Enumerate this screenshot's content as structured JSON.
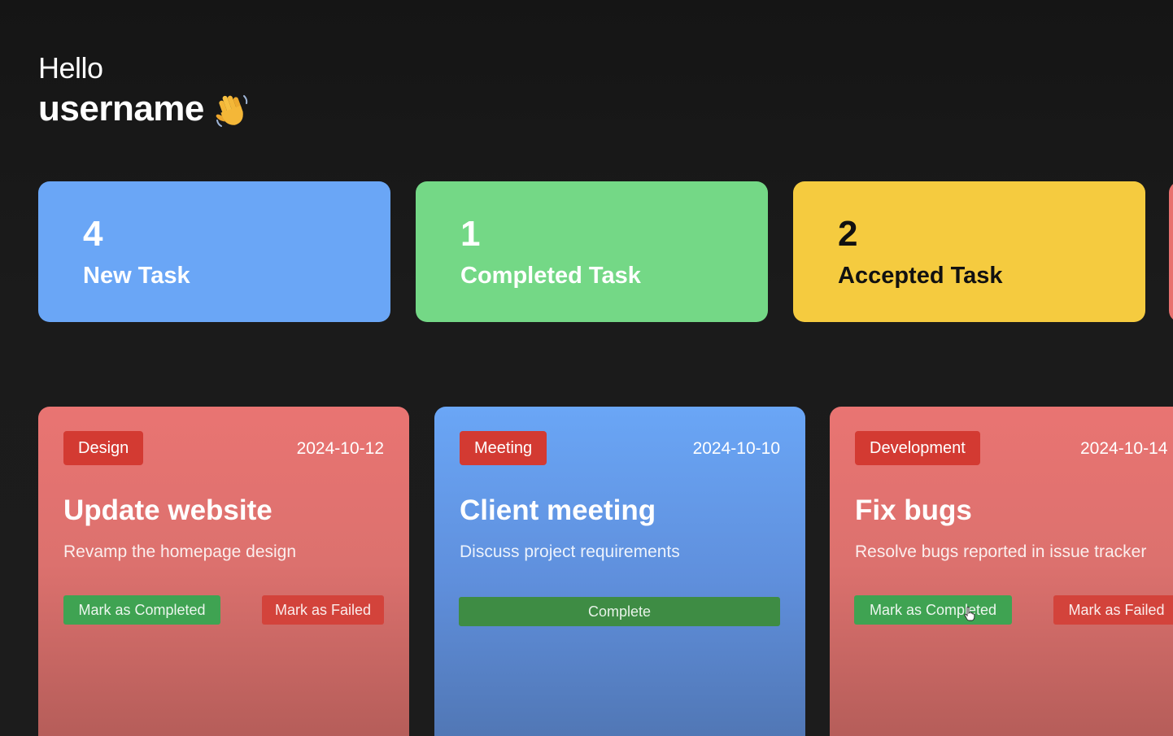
{
  "greeting": {
    "hello": "Hello",
    "username": "username",
    "icon": "waving-hand-icon"
  },
  "stats": [
    {
      "count": "4",
      "label": "New Task",
      "color": "#6aa6f6"
    },
    {
      "count": "1",
      "label": "Completed Task",
      "color": "#74d886"
    },
    {
      "count": "2",
      "label": "Accepted Task",
      "color": "#f5cb3f"
    }
  ],
  "tasks": [
    {
      "category": "Design",
      "date": "2024-10-12",
      "title": "Update website",
      "description": "Revamp the homepage design",
      "actions": [
        "Mark as Completed",
        "Mark as Failed"
      ],
      "color": "#e97472"
    },
    {
      "category": "Meeting",
      "date": "2024-10-10",
      "title": "Client meeting",
      "description": "Discuss project requirements",
      "actions": [
        "Complete"
      ],
      "color": "#6aa6f6"
    },
    {
      "category": "Development",
      "date": "2024-10-14",
      "title": "Fix bugs",
      "description": "Resolve bugs reported in issue tracker",
      "actions": [
        "Mark as Completed",
        "Mark as Failed"
      ],
      "color": "#e97472"
    }
  ],
  "colors": {
    "background": "#1b1b1b",
    "badge": "#d33a32",
    "completed_button": "#3fa352",
    "failed_button": "#d3433b"
  }
}
